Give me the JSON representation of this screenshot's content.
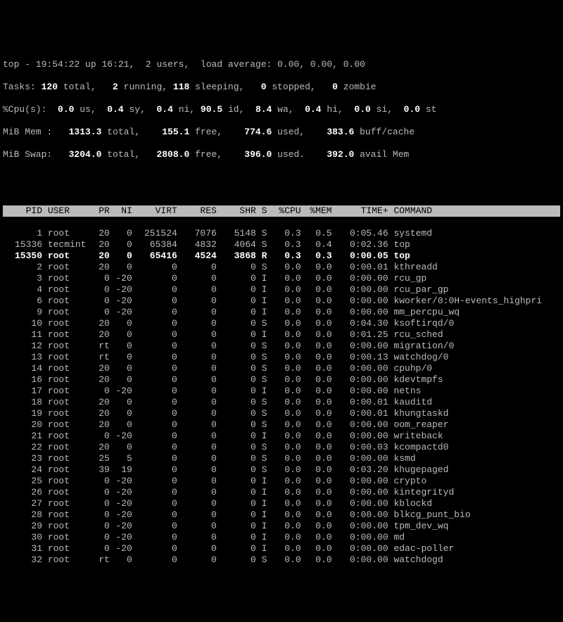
{
  "summary": {
    "line1_prefix": "top - ",
    "time": "19:54:22",
    "up_label": " up ",
    "uptime": "16:21",
    "users_sep": ",  ",
    "users": "2 users",
    "load_sep": ",  ",
    "load_label": "load average: ",
    "load": "0.00, 0.00, 0.00",
    "tasks_label": "Tasks: ",
    "tasks_total": "120 ",
    "tasks_total_lbl": "total,   ",
    "tasks_running": "2 ",
    "tasks_running_lbl": "running, ",
    "tasks_sleeping": "118 ",
    "tasks_sleeping_lbl": "sleeping,   ",
    "tasks_stopped": "0 ",
    "tasks_stopped_lbl": "stopped,   ",
    "tasks_zombie": "0 ",
    "tasks_zombie_lbl": "zombie",
    "cpu_label": "%Cpu(s):  ",
    "cpu_us": "0.0 ",
    "cpu_us_lbl": "us,  ",
    "cpu_sy": "0.4 ",
    "cpu_sy_lbl": "sy,  ",
    "cpu_ni": "0.4 ",
    "cpu_ni_lbl": "ni, ",
    "cpu_id": "90.5 ",
    "cpu_id_lbl": "id,  ",
    "cpu_wa": "8.4 ",
    "cpu_wa_lbl": "wa,  ",
    "cpu_hi": "0.4 ",
    "cpu_hi_lbl": "hi,  ",
    "cpu_si": "0.0 ",
    "cpu_si_lbl": "si,  ",
    "cpu_st": "0.0 ",
    "cpu_st_lbl": "st",
    "mem_label": "MiB Mem :   ",
    "mem_total": "1313.3 ",
    "mem_total_lbl": "total,    ",
    "mem_free": "155.1 ",
    "mem_free_lbl": "free,    ",
    "mem_used": "774.6 ",
    "mem_used_lbl": "used,    ",
    "mem_buff": "383.6 ",
    "mem_buff_lbl": "buff/cache",
    "swap_label": "MiB Swap:   ",
    "swap_total": "3204.0 ",
    "swap_total_lbl": "total,   ",
    "swap_free": "2808.0 ",
    "swap_free_lbl": "free,    ",
    "swap_used": "396.0 ",
    "swap_used_lbl": "used.    ",
    "swap_avail": "392.0 ",
    "swap_avail_lbl": "avail Mem "
  },
  "columns": {
    "pid": "PID",
    "user": "USER",
    "pr": "PR",
    "ni": "NI",
    "virt": "VIRT",
    "res": "RES",
    "shr": "SHR",
    "s": "S",
    "cpu": "%CPU",
    "mem": "%MEM",
    "time": "TIME+",
    "command": "COMMAND"
  },
  "processes": [
    {
      "pid": "1",
      "user": "root",
      "pr": "20",
      "ni": "0",
      "virt": "251524",
      "res": "7076",
      "shr": "5148",
      "s": "S",
      "cpu": "0.3",
      "mem": "0.5",
      "time": "0:05.46",
      "command": "systemd",
      "bold": false
    },
    {
      "pid": "15336",
      "user": "tecmint",
      "pr": "20",
      "ni": "0",
      "virt": "65384",
      "res": "4832",
      "shr": "4064",
      "s": "S",
      "cpu": "0.3",
      "mem": "0.4",
      "time": "0:02.36",
      "command": "top",
      "bold": false
    },
    {
      "pid": "15350",
      "user": "root",
      "pr": "20",
      "ni": "0",
      "virt": "65416",
      "res": "4524",
      "shr": "3868",
      "s": "R",
      "cpu": "0.3",
      "mem": "0.3",
      "time": "0:00.05",
      "command": "top",
      "bold": true
    },
    {
      "pid": "2",
      "user": "root",
      "pr": "20",
      "ni": "0",
      "virt": "0",
      "res": "0",
      "shr": "0",
      "s": "S",
      "cpu": "0.0",
      "mem": "0.0",
      "time": "0:00.01",
      "command": "kthreadd",
      "bold": false
    },
    {
      "pid": "3",
      "user": "root",
      "pr": "0",
      "ni": "-20",
      "virt": "0",
      "res": "0",
      "shr": "0",
      "s": "I",
      "cpu": "0.0",
      "mem": "0.0",
      "time": "0:00.00",
      "command": "rcu_gp",
      "bold": false
    },
    {
      "pid": "4",
      "user": "root",
      "pr": "0",
      "ni": "-20",
      "virt": "0",
      "res": "0",
      "shr": "0",
      "s": "I",
      "cpu": "0.0",
      "mem": "0.0",
      "time": "0:00.00",
      "command": "rcu_par_gp",
      "bold": false
    },
    {
      "pid": "6",
      "user": "root",
      "pr": "0",
      "ni": "-20",
      "virt": "0",
      "res": "0",
      "shr": "0",
      "s": "I",
      "cpu": "0.0",
      "mem": "0.0",
      "time": "0:00.00",
      "command": "kworker/0:0H-events_highpri",
      "bold": false
    },
    {
      "pid": "9",
      "user": "root",
      "pr": "0",
      "ni": "-20",
      "virt": "0",
      "res": "0",
      "shr": "0",
      "s": "I",
      "cpu": "0.0",
      "mem": "0.0",
      "time": "0:00.00",
      "command": "mm_percpu_wq",
      "bold": false
    },
    {
      "pid": "10",
      "user": "root",
      "pr": "20",
      "ni": "0",
      "virt": "0",
      "res": "0",
      "shr": "0",
      "s": "S",
      "cpu": "0.0",
      "mem": "0.0",
      "time": "0:04.30",
      "command": "ksoftirqd/0",
      "bold": false
    },
    {
      "pid": "11",
      "user": "root",
      "pr": "20",
      "ni": "0",
      "virt": "0",
      "res": "0",
      "shr": "0",
      "s": "I",
      "cpu": "0.0",
      "mem": "0.0",
      "time": "0:01.25",
      "command": "rcu_sched",
      "bold": false
    },
    {
      "pid": "12",
      "user": "root",
      "pr": "rt",
      "ni": "0",
      "virt": "0",
      "res": "0",
      "shr": "0",
      "s": "S",
      "cpu": "0.0",
      "mem": "0.0",
      "time": "0:00.00",
      "command": "migration/0",
      "bold": false
    },
    {
      "pid": "13",
      "user": "root",
      "pr": "rt",
      "ni": "0",
      "virt": "0",
      "res": "0",
      "shr": "0",
      "s": "S",
      "cpu": "0.0",
      "mem": "0.0",
      "time": "0:00.13",
      "command": "watchdog/0",
      "bold": false
    },
    {
      "pid": "14",
      "user": "root",
      "pr": "20",
      "ni": "0",
      "virt": "0",
      "res": "0",
      "shr": "0",
      "s": "S",
      "cpu": "0.0",
      "mem": "0.0",
      "time": "0:00.00",
      "command": "cpuhp/0",
      "bold": false
    },
    {
      "pid": "16",
      "user": "root",
      "pr": "20",
      "ni": "0",
      "virt": "0",
      "res": "0",
      "shr": "0",
      "s": "S",
      "cpu": "0.0",
      "mem": "0.0",
      "time": "0:00.00",
      "command": "kdevtmpfs",
      "bold": false
    },
    {
      "pid": "17",
      "user": "root",
      "pr": "0",
      "ni": "-20",
      "virt": "0",
      "res": "0",
      "shr": "0",
      "s": "I",
      "cpu": "0.0",
      "mem": "0.0",
      "time": "0:00.00",
      "command": "netns",
      "bold": false
    },
    {
      "pid": "18",
      "user": "root",
      "pr": "20",
      "ni": "0",
      "virt": "0",
      "res": "0",
      "shr": "0",
      "s": "S",
      "cpu": "0.0",
      "mem": "0.0",
      "time": "0:00.01",
      "command": "kauditd",
      "bold": false
    },
    {
      "pid": "19",
      "user": "root",
      "pr": "20",
      "ni": "0",
      "virt": "0",
      "res": "0",
      "shr": "0",
      "s": "S",
      "cpu": "0.0",
      "mem": "0.0",
      "time": "0:00.01",
      "command": "khungtaskd",
      "bold": false
    },
    {
      "pid": "20",
      "user": "root",
      "pr": "20",
      "ni": "0",
      "virt": "0",
      "res": "0",
      "shr": "0",
      "s": "S",
      "cpu": "0.0",
      "mem": "0.0",
      "time": "0:00.00",
      "command": "oom_reaper",
      "bold": false
    },
    {
      "pid": "21",
      "user": "root",
      "pr": "0",
      "ni": "-20",
      "virt": "0",
      "res": "0",
      "shr": "0",
      "s": "I",
      "cpu": "0.0",
      "mem": "0.0",
      "time": "0:00.00",
      "command": "writeback",
      "bold": false
    },
    {
      "pid": "22",
      "user": "root",
      "pr": "20",
      "ni": "0",
      "virt": "0",
      "res": "0",
      "shr": "0",
      "s": "S",
      "cpu": "0.0",
      "mem": "0.0",
      "time": "0:00.03",
      "command": "kcompactd0",
      "bold": false
    },
    {
      "pid": "23",
      "user": "root",
      "pr": "25",
      "ni": "5",
      "virt": "0",
      "res": "0",
      "shr": "0",
      "s": "S",
      "cpu": "0.0",
      "mem": "0.0",
      "time": "0:00.00",
      "command": "ksmd",
      "bold": false
    },
    {
      "pid": "24",
      "user": "root",
      "pr": "39",
      "ni": "19",
      "virt": "0",
      "res": "0",
      "shr": "0",
      "s": "S",
      "cpu": "0.0",
      "mem": "0.0",
      "time": "0:03.20",
      "command": "khugepaged",
      "bold": false
    },
    {
      "pid": "25",
      "user": "root",
      "pr": "0",
      "ni": "-20",
      "virt": "0",
      "res": "0",
      "shr": "0",
      "s": "I",
      "cpu": "0.0",
      "mem": "0.0",
      "time": "0:00.00",
      "command": "crypto",
      "bold": false
    },
    {
      "pid": "26",
      "user": "root",
      "pr": "0",
      "ni": "-20",
      "virt": "0",
      "res": "0",
      "shr": "0",
      "s": "I",
      "cpu": "0.0",
      "mem": "0.0",
      "time": "0:00.00",
      "command": "kintegrityd",
      "bold": false
    },
    {
      "pid": "27",
      "user": "root",
      "pr": "0",
      "ni": "-20",
      "virt": "0",
      "res": "0",
      "shr": "0",
      "s": "I",
      "cpu": "0.0",
      "mem": "0.0",
      "time": "0:00.00",
      "command": "kblockd",
      "bold": false
    },
    {
      "pid": "28",
      "user": "root",
      "pr": "0",
      "ni": "-20",
      "virt": "0",
      "res": "0",
      "shr": "0",
      "s": "I",
      "cpu": "0.0",
      "mem": "0.0",
      "time": "0:00.00",
      "command": "blkcg_punt_bio",
      "bold": false
    },
    {
      "pid": "29",
      "user": "root",
      "pr": "0",
      "ni": "-20",
      "virt": "0",
      "res": "0",
      "shr": "0",
      "s": "I",
      "cpu": "0.0",
      "mem": "0.0",
      "time": "0:00.00",
      "command": "tpm_dev_wq",
      "bold": false
    },
    {
      "pid": "30",
      "user": "root",
      "pr": "0",
      "ni": "-20",
      "virt": "0",
      "res": "0",
      "shr": "0",
      "s": "I",
      "cpu": "0.0",
      "mem": "0.0",
      "time": "0:00.00",
      "command": "md",
      "bold": false
    },
    {
      "pid": "31",
      "user": "root",
      "pr": "0",
      "ni": "-20",
      "virt": "0",
      "res": "0",
      "shr": "0",
      "s": "I",
      "cpu": "0.0",
      "mem": "0.0",
      "time": "0:00.00",
      "command": "edac-poller",
      "bold": false
    },
    {
      "pid": "32",
      "user": "root",
      "pr": "rt",
      "ni": "0",
      "virt": "0",
      "res": "0",
      "shr": "0",
      "s": "S",
      "cpu": "0.0",
      "mem": "0.0",
      "time": "0:00.00",
      "command": "watchdogd",
      "bold": false
    }
  ]
}
